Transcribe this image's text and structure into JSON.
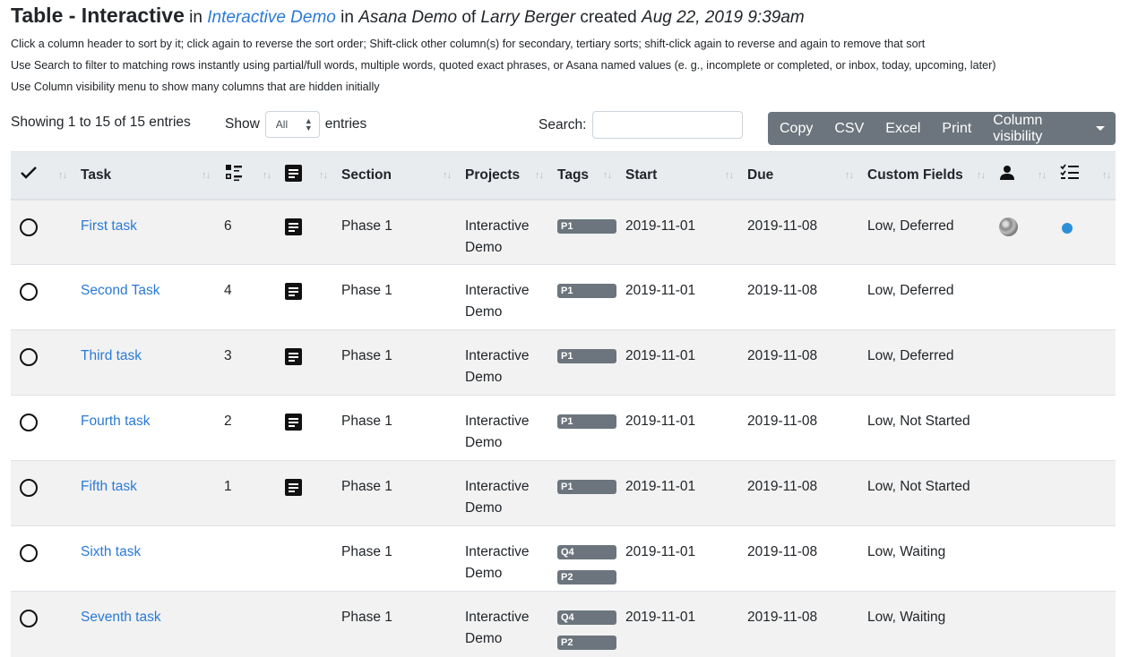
{
  "header": {
    "title": "Table - Interactive",
    "in1": "in",
    "project_link": "Interactive Demo",
    "in2": "in",
    "workspace": "Asana Demo",
    "of": "of",
    "owner": "Larry Berger",
    "created": "created",
    "date": "Aug 22, 2019 9:39am"
  },
  "help": [
    "Click a column header to sort by it; click again to reverse the sort order; Shift-click other column(s) for secondary, tertiary sorts; shift-click again to reverse and again to remove that sort",
    "Use Search to filter to matching rows instantly using partial/full words, multiple words, quoted exact phrases, or Asana named values (e. g., incomplete or completed, or inbox, today, upcoming, later)",
    "Use Column visibility menu to show many columns that are hidden initially"
  ],
  "controls": {
    "info": "Showing 1 to 15 of 15 entries",
    "show_label": "Show",
    "length_value": "All",
    "entries_label": "entries",
    "search_label": "Search:",
    "buttons": [
      "Copy",
      "CSV",
      "Excel",
      "Print",
      "Column visibility"
    ]
  },
  "icons": {
    "completed_col": "checkmark-icon",
    "subtasks_col": "checklist-icon",
    "notes_col": "notes-icon",
    "assignee_col": "person-icon",
    "dependencies_col": "task-list-icon",
    "sort": "sort-arrows-icon"
  },
  "colors": {
    "link": "#2a7ad6",
    "button_bg": "#6c757d",
    "dot": "#2d8fd9"
  },
  "columns": [
    "Task",
    "Section",
    "Projects",
    "Tags",
    "Start",
    "Due",
    "Custom Fields"
  ],
  "rows": [
    {
      "task": "First task",
      "subtasks": "6",
      "has_notes": true,
      "section": "Phase 1",
      "project": [
        "Interactive",
        "Demo"
      ],
      "tags": [
        "P1"
      ],
      "start": "2019-11-01",
      "due": "2019-11-08",
      "custom": "Low, Deferred",
      "has_avatar": true,
      "has_dot": true
    },
    {
      "task": "Second Task",
      "subtasks": "4",
      "has_notes": true,
      "section": "Phase 1",
      "project": [
        "Interactive",
        "Demo"
      ],
      "tags": [
        "P1"
      ],
      "start": "2019-11-01",
      "due": "2019-11-08",
      "custom": "Low, Deferred",
      "has_avatar": false,
      "has_dot": false
    },
    {
      "task": "Third task",
      "subtasks": "3",
      "has_notes": true,
      "section": "Phase 1",
      "project": [
        "Interactive",
        "Demo"
      ],
      "tags": [
        "P1"
      ],
      "start": "2019-11-01",
      "due": "2019-11-08",
      "custom": "Low, Deferred",
      "has_avatar": false,
      "has_dot": false
    },
    {
      "task": "Fourth task",
      "subtasks": "2",
      "has_notes": true,
      "section": "Phase 1",
      "project": [
        "Interactive",
        "Demo"
      ],
      "tags": [
        "P1"
      ],
      "start": "2019-11-01",
      "due": "2019-11-08",
      "custom": "Low, Not Started",
      "has_avatar": false,
      "has_dot": false
    },
    {
      "task": "Fifth task",
      "subtasks": "1",
      "has_notes": true,
      "section": "Phase 1",
      "project": [
        "Interactive",
        "Demo"
      ],
      "tags": [
        "P1"
      ],
      "start": "2019-11-01",
      "due": "2019-11-08",
      "custom": "Low, Not Started",
      "has_avatar": false,
      "has_dot": false
    },
    {
      "task": "Sixth task",
      "subtasks": "",
      "has_notes": false,
      "section": "Phase 1",
      "project": [
        "Interactive",
        "Demo"
      ],
      "tags": [
        "Q4",
        "P2"
      ],
      "start": "2019-11-01",
      "due": "2019-11-08",
      "custom": "Low, Waiting",
      "has_avatar": false,
      "has_dot": false
    },
    {
      "task": "Seventh task",
      "subtasks": "",
      "has_notes": false,
      "section": "Phase 1",
      "project": [
        "Interactive",
        "Demo"
      ],
      "tags": [
        "Q4",
        "P2"
      ],
      "start": "2019-11-01",
      "due": "2019-11-08",
      "custom": "Low, Waiting",
      "has_avatar": false,
      "has_dot": false
    }
  ]
}
